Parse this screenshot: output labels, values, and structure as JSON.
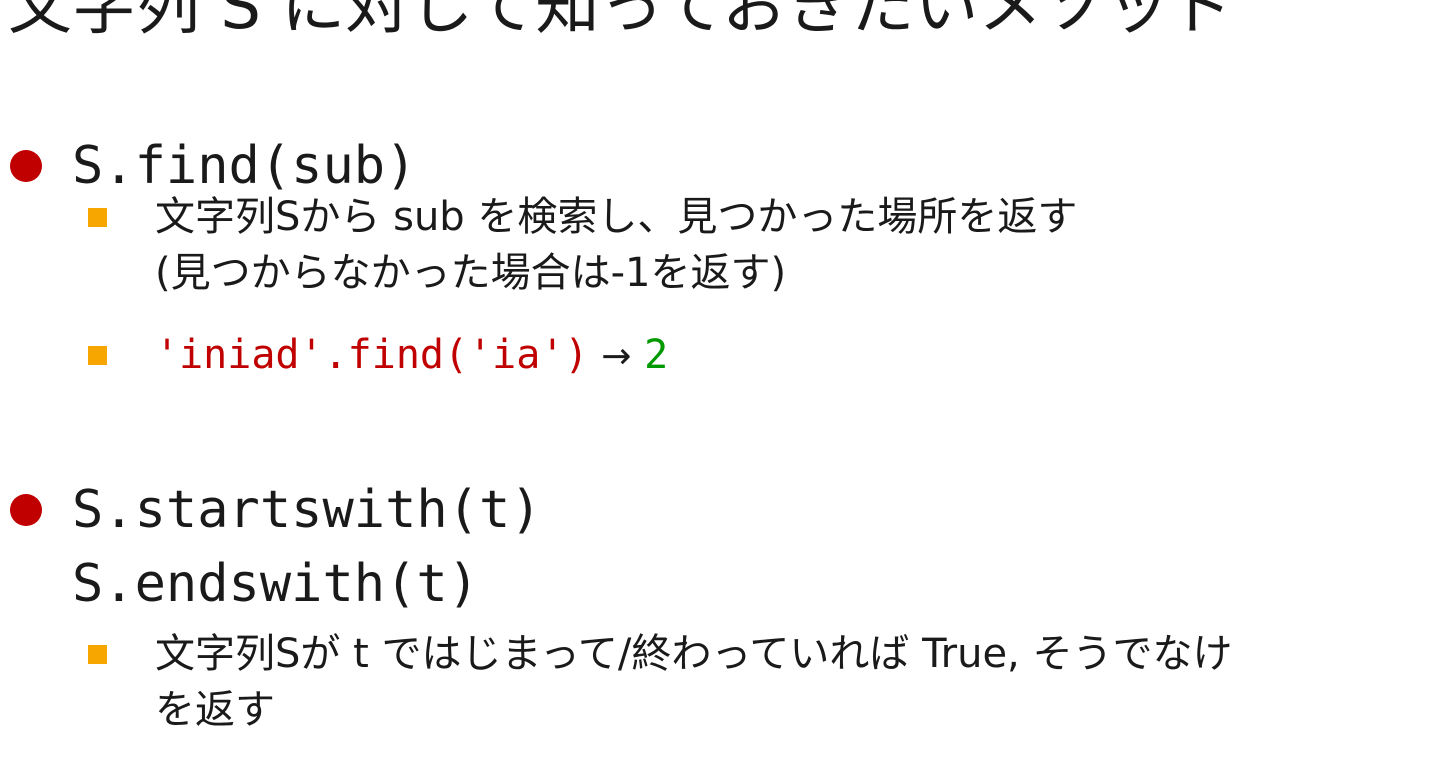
{
  "slide": {
    "title": "文字列 S に対して知っておきたいメソッド",
    "sections": [
      {
        "heading": "S.find(sub)",
        "description_line1": "文字列Sから sub を検索し、見つかった場所を返す",
        "description_line2": "(見つからなかった場合は-1を返す)",
        "example_code": "'iniad'.find('ia')",
        "example_arrow": "→",
        "example_result": "2"
      },
      {
        "heading_line1": "S.startswith(t)",
        "heading_line2": "S.endswith(t)",
        "description_line1": "文字列Sが t ではじまって/終わっていれば True, そうでなけ",
        "description_line2": "を返す"
      }
    ]
  },
  "colors": {
    "bullet_primary": "#c00000",
    "bullet_secondary": "#f7a600",
    "code_string": "#c00000",
    "result_value": "#009900"
  }
}
